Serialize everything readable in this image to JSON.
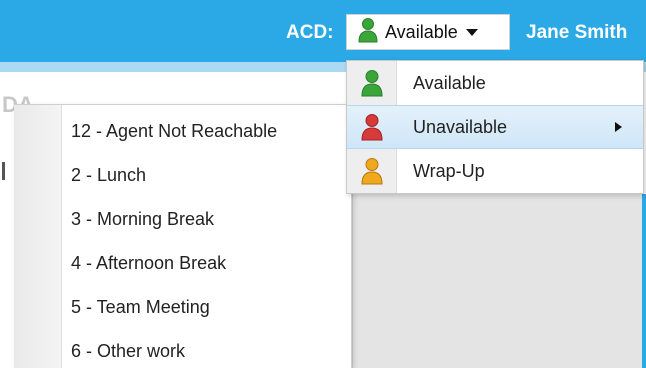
{
  "header": {
    "acd_label": "ACD:",
    "status_selected": "Available",
    "user_name": "Jane Smith"
  },
  "status_menu": {
    "items": [
      {
        "label": "Available",
        "icon": "person-icon",
        "color": "#3aa63a"
      },
      {
        "label": "Unavailable",
        "icon": "person-icon",
        "color": "#d63a3a",
        "has_submenu": true
      },
      {
        "label": "Wrap-Up",
        "icon": "person-icon",
        "color": "#f0a81e"
      }
    ]
  },
  "unavailable_submenu": {
    "items": [
      {
        "label": "12 - Agent Not Reachable"
      },
      {
        "label": "2 - Lunch"
      },
      {
        "label": "3 - Morning Break"
      },
      {
        "label": "4 - Afternoon Break"
      },
      {
        "label": "5 - Team Meeting"
      },
      {
        "label": "6 - Other work"
      }
    ]
  },
  "colors": {
    "accent": "#2ba8e6",
    "menu_highlight": "#cfe6f7"
  }
}
